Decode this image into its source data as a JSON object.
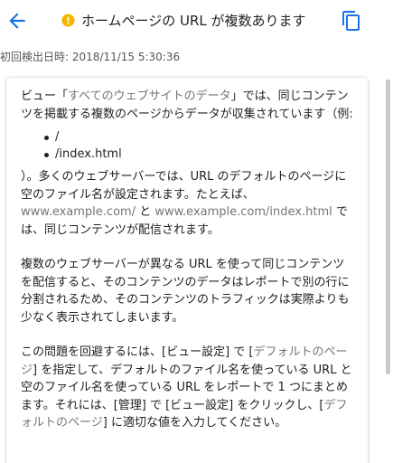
{
  "header": {
    "title": "ホームページの URL が複数あります",
    "back_icon": "arrow-back-icon",
    "status_icon": "warning-icon",
    "copy_icon": "copy-icon",
    "accent_color": "#1a73e8",
    "warning_color": "#f4b400"
  },
  "detected": "初回検出日時: 2018/11/15 5:30:36",
  "content": {
    "p1_a": "ビュー「",
    "p1_link": "すべてのウェブサイトのデータ",
    "p1_b": "」では、同じコンテンツを掲載する複数のページからデータが収集されています（例:",
    "examples": [
      "/",
      "/index.html"
    ],
    "p2_a": "）。多くのウェブサーバーでは、URL のデフォルトのページに空のファイル名が設定されます。たとえば、",
    "p2_link1": "www.example.com/",
    "p2_mid": " と ",
    "p2_link2": "www.example.com/index.html",
    "p2_b": " では、同じコンテンツが配信されます。",
    "p3": "複数のウェブサーバーが異なる URL を使って同じコンテンツを配信すると、そのコンテンツのデータはレポートで別の行に分割されるため、そのコンテンツのトラフィックは実際よりも少なく表示されてしまいます。",
    "p4_a": "この問題を回避するには、[ビュー設定] で [",
    "p4_link1": "デフォルトのページ",
    "p4_b": "] を指定して、デフォルトのファイル名を使っている URL と空のファイル名を使っている URL をレポートで 1 つにまとめます。それには、[管理] で [ビュー設定] をクリックし、[",
    "p4_link2": "デフォルトのページ",
    "p4_c": "] に適切な値を入力してください。"
  }
}
